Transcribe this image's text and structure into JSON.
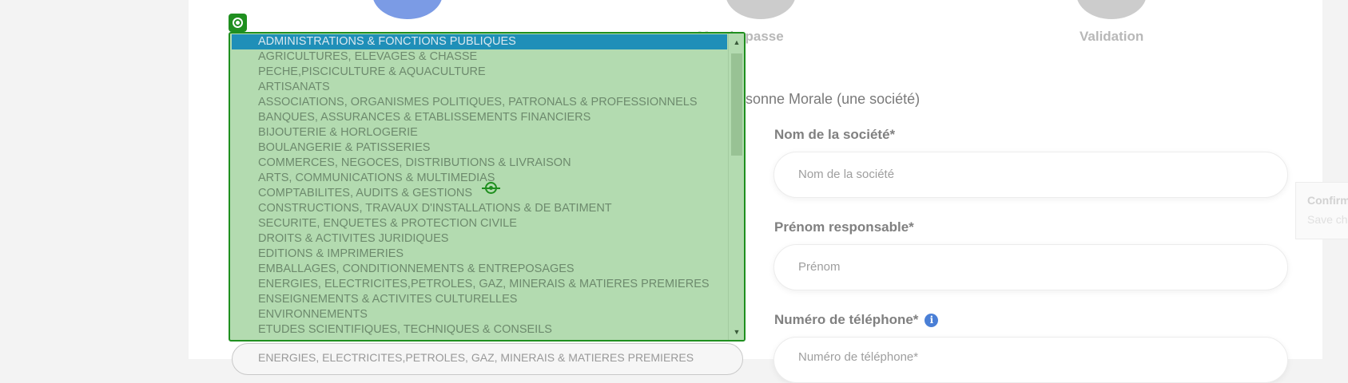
{
  "steps": [
    {
      "label": ""
    },
    {
      "label": "Mot de passe"
    },
    {
      "label": "Validation"
    }
  ],
  "type_label": "ersonne Morale (une société)",
  "fields": {
    "company_name": {
      "label": "Nom de la société*",
      "placeholder": "Nom de la société"
    },
    "first_name": {
      "label": "Prénom responsable*",
      "placeholder": "Prénom"
    },
    "phone": {
      "label": "Numéro de téléphone*",
      "placeholder": "Numéro de téléphone*",
      "info_icon": "i"
    }
  },
  "toast": {
    "title": "Confirm",
    "subtitle": "Save ch"
  },
  "sector_select": {
    "value": "ENERGIES, ELECTRICITES,PETROLES, GAZ, MINERAIS & MATIERES PREMIERES",
    "selected_index": 0,
    "options": [
      "ADMINISTRATIONS & FONCTIONS PUBLIQUES",
      "AGRICULTURES, ELEVAGES & CHASSE",
      "PECHE,PISCICULTURE & AQUACULTURE",
      "ARTISANATS",
      "ASSOCIATIONS, ORGANISMES POLITIQUES, PATRONALS & PROFESSIONNELS",
      "BANQUES, ASSURANCES & ETABLISSEMENTS FINANCIERS",
      "BIJOUTERIE & HORLOGERIE",
      "BOULANGERIE & PATISSERIES",
      "COMMERCES, NEGOCES, DISTRIBUTIONS & LIVRAISON",
      "ARTS, COMMUNICATIONS & MULTIMEDIAS",
      "COMPTABILITES, AUDITS & GESTIONS",
      "CONSTRUCTIONS, TRAVAUX D'INSTALLATIONS & DE BATIMENT",
      "SECURITE, ENQUETES & PROTECTION CIVILE",
      "DROITS & ACTIVITES JURIDIQUES",
      "EDITIONS & IMPRIMERIES",
      "EMBALLAGES, CONDITIONNEMENTS & ENTREPOSAGES",
      "ENERGIES, ELECTRICITES,PETROLES, GAZ, MINERAIS & MATIERES PREMIERES",
      "ENSEIGNEMENTS & ACTIVITES CULTURELLES",
      "ENVIRONNEMENTS",
      "ETUDES SCIENTIFIQUES, TECHNIQUES & CONSEILS"
    ]
  },
  "colors": {
    "active_step": "#7b9be5",
    "inactive_step": "#cccccc",
    "overlay_border": "#1f8f1f",
    "overlay_fill": "#b3dbb0",
    "selected_option": "#1f8fb8",
    "info_icon": "#4a7fd6"
  },
  "icons": {
    "overlay_handle": "target-icon",
    "cursor": "crosshair-icon",
    "scroll_up": "chevron-up-icon",
    "scroll_down": "chevron-down-icon",
    "info": "info-icon"
  }
}
